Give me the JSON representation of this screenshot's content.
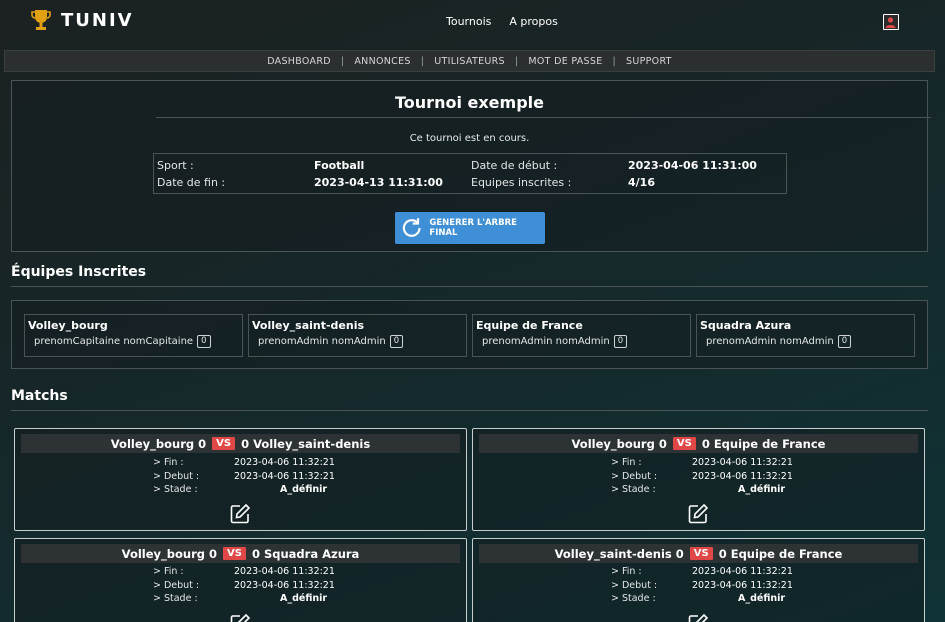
{
  "brand": {
    "name": "TUNIV",
    "logo_icon": "trophy-icon",
    "accent": "#e0a010"
  },
  "topnav": {
    "items": [
      "Tournois",
      "A propos"
    ],
    "profile_icon": "user-profile-icon"
  },
  "subnav": {
    "items": [
      "DASHBOARD",
      "ANNONCES",
      "UTILISATEURS",
      "MOT DE PASSE",
      "SUPPORT"
    ],
    "separator": "|"
  },
  "tournament": {
    "title": "Tournoi exemple",
    "status": "Ce tournoi est en cours.",
    "sport_label": "Sport :",
    "sport": "Football",
    "end_label": "Date de fin :",
    "end": "2023-04-13 11:31:00",
    "start_label": "Date de début :",
    "start": "2023-04-06 11:31:00",
    "teams_label": "Equipes inscrites :",
    "teams": "4/16",
    "generate_button": "GENERER L'ARBRE FINAL",
    "button_color": "#3e8fd6"
  },
  "teams_section": {
    "title": "Équipes Inscrites",
    "teams": [
      {
        "name": "Volley_bourg",
        "captain": "prenomCapitaine nomCapitaine",
        "count": "0"
      },
      {
        "name": "Volley_saint-denis",
        "captain": "prenomAdmin nomAdmin",
        "count": "0"
      },
      {
        "name": "Equipe de France",
        "captain": "prenomAdmin nomAdmin",
        "count": "0"
      },
      {
        "name": "Squadra Azura",
        "captain": "prenomAdmin nomAdmin",
        "count": "0"
      }
    ]
  },
  "matches_section": {
    "title": "Matchs",
    "vs_label": "VS",
    "vs_color": "#e04848",
    "fin_label": "> Fin :",
    "debut_label": "> Debut :",
    "stade_label": "> Stade :",
    "matches": [
      {
        "team1": "Volley_bourg 0",
        "team2": "0 Volley_saint-denis",
        "fin": "2023-04-06 11:32:21",
        "debut": "2023-04-06 11:32:21",
        "stade": "A_définir"
      },
      {
        "team1": "Volley_bourg 0",
        "team2": "0 Equipe de France",
        "fin": "2023-04-06 11:32:21",
        "debut": "2023-04-06 11:32:21",
        "stade": "A_définir"
      },
      {
        "team1": "Volley_bourg 0",
        "team2": "0 Squadra Azura",
        "fin": "2023-04-06 11:32:21",
        "debut": "2023-04-06 11:32:21",
        "stade": "A_définir"
      },
      {
        "team1": "Volley_saint-denis 0",
        "team2": "0 Equipe de France",
        "fin": "2023-04-06 11:32:21",
        "debut": "2023-04-06 11:32:21",
        "stade": "A_définir"
      }
    ]
  }
}
